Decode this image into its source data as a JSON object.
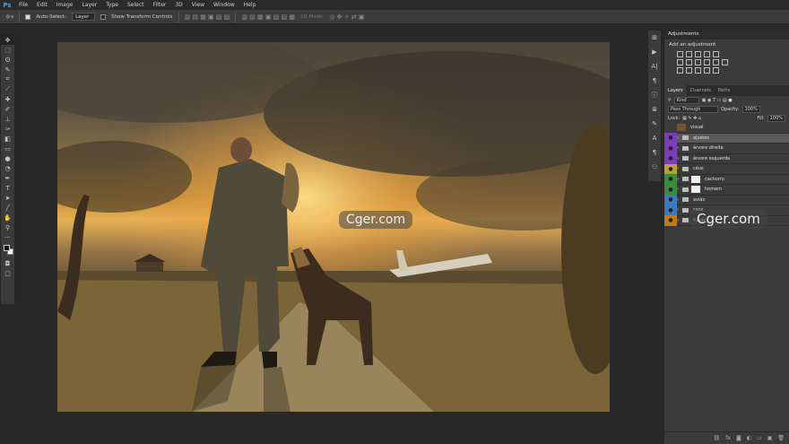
{
  "app": {
    "logo": "Ps"
  },
  "menu": [
    "File",
    "Edit",
    "Image",
    "Layer",
    "Type",
    "Select",
    "Filter",
    "3D",
    "View",
    "Window",
    "Help"
  ],
  "options": {
    "auto_select_label": "Auto-Select:",
    "auto_select_value": "Layer",
    "transform_label": "Show Transform Controls",
    "mode_3d_label": "3D Mode:"
  },
  "watermark": "Cger.com",
  "adjustments": {
    "tab": "Adjustments",
    "title": "Add an adjustment"
  },
  "layers_panel": {
    "tabs": [
      "Layers",
      "Channels",
      "Paths"
    ],
    "kind_label": "Kind",
    "blend_mode": "Pass Through",
    "opacity_label": "Opacity:",
    "opacity_value": "100%",
    "lock_label": "Lock:",
    "fill_label": "Fill:",
    "fill_value": "100%",
    "layers": [
      {
        "name": "visual",
        "eye_color": "#3b3b3b",
        "type": "image"
      },
      {
        "name": "ajustes",
        "eye_color": "#7a3fb8",
        "type": "folder"
      },
      {
        "name": "árvore direita",
        "eye_color": "#7a3fb8",
        "type": "folder"
      },
      {
        "name": "árvore esquerda",
        "eye_color": "#7a3fb8",
        "type": "folder"
      },
      {
        "name": "céus",
        "eye_color": "#b8a032",
        "type": "folder"
      },
      {
        "name": "cachorro",
        "eye_color": "#3c8a3c",
        "type": "folder-mask"
      },
      {
        "name": "homem",
        "eye_color": "#3c8a3c",
        "type": "folder-mask"
      },
      {
        "name": "avião",
        "eye_color": "#3a7bbf",
        "type": "folder"
      },
      {
        "name": "casa",
        "eye_color": "#3a7bbf",
        "type": "folder"
      },
      {
        "name": "fundo",
        "eye_color": "#c07a18",
        "type": "folder"
      }
    ]
  }
}
